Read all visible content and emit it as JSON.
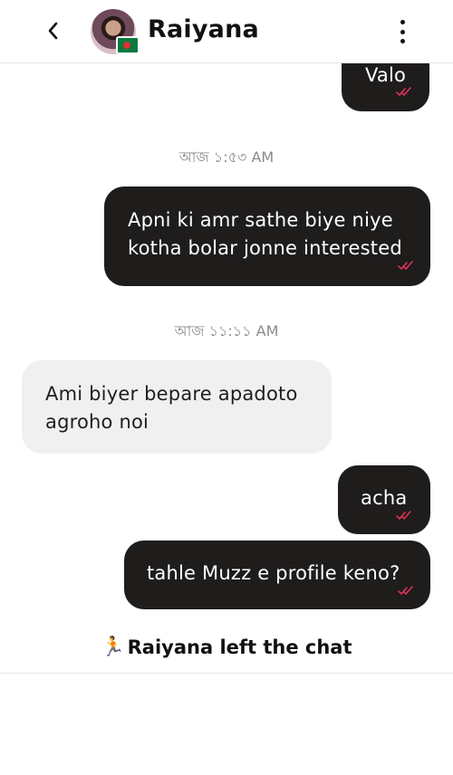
{
  "header": {
    "contact_name": "Raiyana",
    "icons": [
      "back-chevron-icon",
      "avatar",
      "bangladesh-flag-icon",
      "more-vertical-icon"
    ]
  },
  "messages": [
    {
      "direction": "outgoing",
      "text": "Valo",
      "status": "read"
    },
    {
      "type": "timestamp",
      "text": "আজ ১:৫৩ AM"
    },
    {
      "direction": "outgoing",
      "lines": [
        "Apni ki amr sathe biye niye",
        "kotha bolar jonne interested"
      ],
      "status": "read"
    },
    {
      "type": "timestamp",
      "text": "আজ ১১:১১ AM"
    },
    {
      "direction": "incoming",
      "lines": [
        "Ami biyer bepare apadoto",
        "agroho noi"
      ]
    },
    {
      "direction": "outgoing",
      "text": "acha",
      "status": "read"
    },
    {
      "direction": "outgoing",
      "text": "tahle Muzz e profile keno?",
      "status": "read"
    }
  ],
  "system_note": {
    "emoji": "🏃",
    "text": "Raiyana left the chat"
  },
  "colors": {
    "outgoing_bubble": "#1f1c1c",
    "incoming_bubble": "#f0f0f0",
    "read_ticks": "#e8345a",
    "timestamp": "#8a8a8a"
  }
}
